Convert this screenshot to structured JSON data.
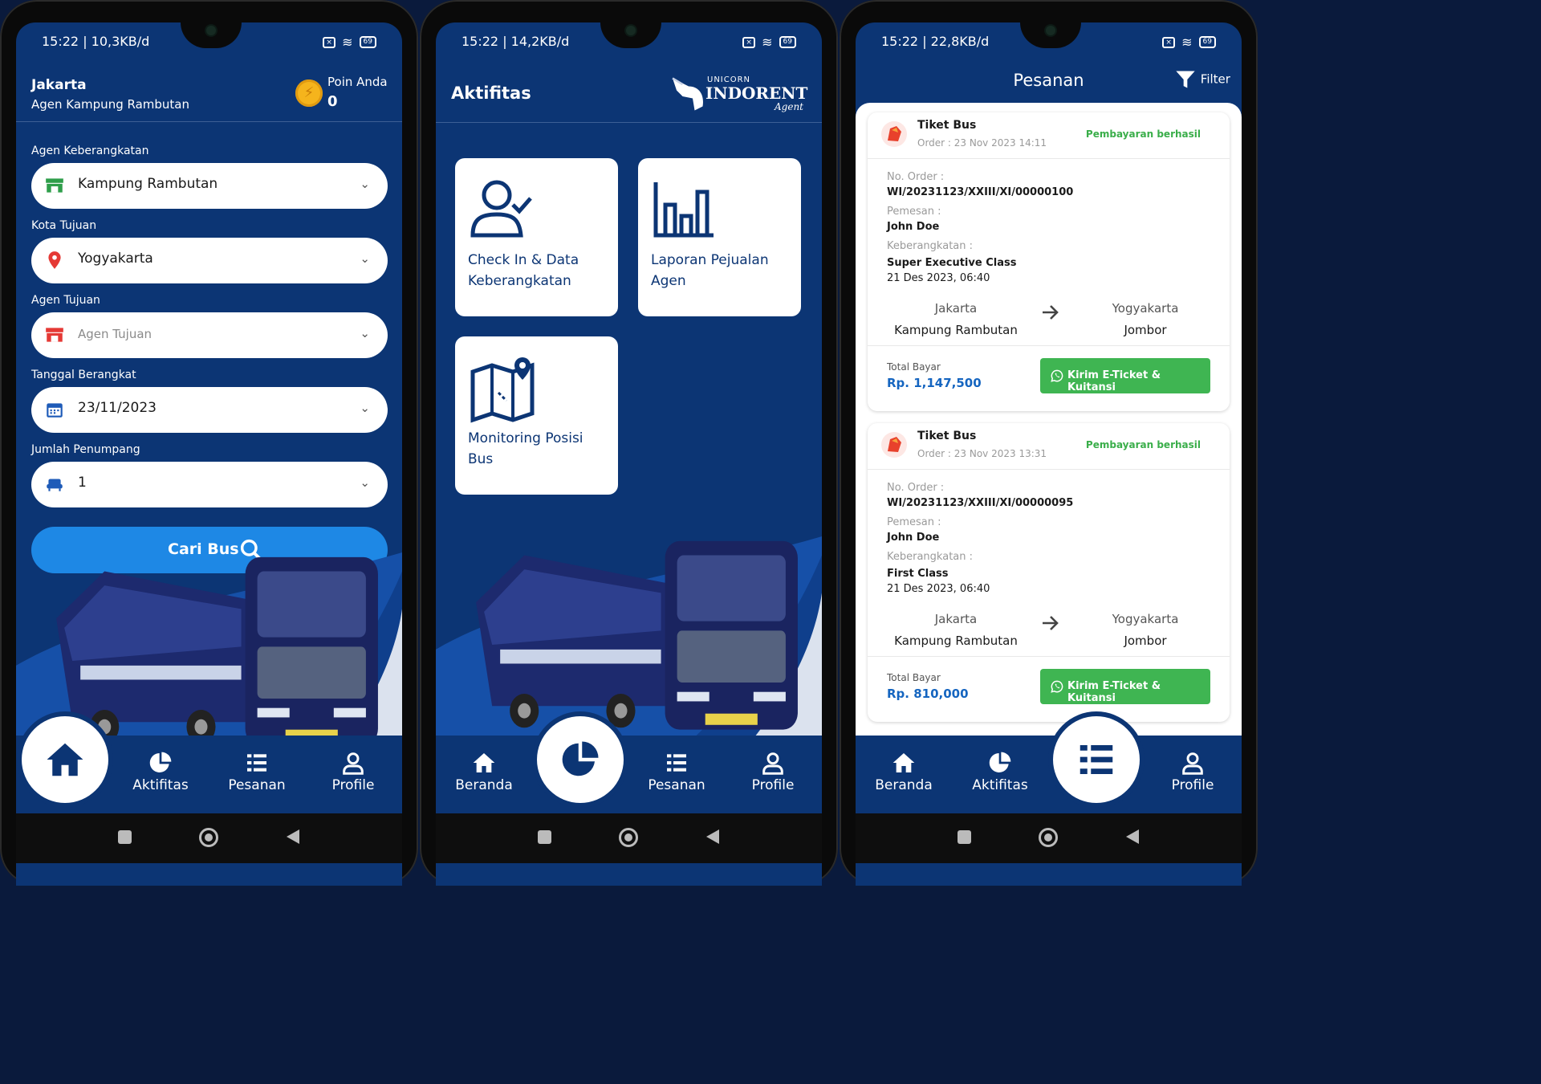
{
  "status_bars": [
    {
      "time": "15:22 | 10,3KB/d",
      "battery": "69"
    },
    {
      "time": "15:22 | 14,2KB/d",
      "battery": "69"
    },
    {
      "time": "15:22 | 22,8KB/d",
      "battery": "69"
    }
  ],
  "home": {
    "city": "Jakarta",
    "agent": "Agen Kampung Rambutan",
    "points_label": "Poin Anda",
    "points_value": "0",
    "fields": [
      {
        "label": "Agen Keberangkatan",
        "value": "Kampung Rambutan",
        "icon": "store-icon",
        "color": "#2e9e4a"
      },
      {
        "label": "Kota Tujuan",
        "value": "Yogyakarta",
        "icon": "location-pin-icon",
        "color": "#e53935"
      },
      {
        "label": "Agen Tujuan",
        "placeholder": "Agen Tujuan",
        "icon": "store-icon",
        "color": "#e53935"
      },
      {
        "label": "Tanggal Berangkat",
        "value": "23/11/2023",
        "icon": "calendar-icon",
        "color": "#1e5bb8"
      },
      {
        "label": "Jumlah Penumpang",
        "value": "1",
        "icon": "seat-icon",
        "color": "#1e5bb8"
      }
    ],
    "search_button": "Cari Bus"
  },
  "aktifitas": {
    "title": "Aktifitas",
    "logo": {
      "top": "UNICORN",
      "main": "INDORENT",
      "sub": "Agent"
    },
    "cards": [
      {
        "label": "Check In & Data Keberangkatan",
        "icon": "user-check-icon"
      },
      {
        "label": "Laporan Pejualan Agen",
        "icon": "bar-chart-icon"
      },
      {
        "label": "Monitoring Posisi Bus",
        "icon": "map-pin-icon"
      }
    ]
  },
  "pesanan": {
    "title": "Pesanan",
    "filter_label": "Filter",
    "orders": [
      {
        "type": "Tiket Bus",
        "order_date": "Order : 23 Nov 2023 14:11",
        "status": "Pembayaran berhasil",
        "no_order_label": "No. Order :",
        "no_order": "WI/20231123/XXIII/XI/00000100",
        "pemesan_label": "Pemesan :",
        "pemesan": "John Doe",
        "keberangkatan_label": "Keberangkatan :",
        "class": "Super Executive Class",
        "departure": "21 Des 2023, 06:40",
        "from_city": "Jakarta",
        "from_agent": "Kampung Rambutan",
        "to_city": "Yogyakarta",
        "to_agent": "Jombor",
        "total_label": "Total Bayar",
        "total": "Rp. 1,147,500",
        "action": "Kirim E-Ticket & Kuitansi"
      },
      {
        "type": "Tiket Bus",
        "order_date": "Order : 23 Nov 2023 13:31",
        "status": "Pembayaran berhasil",
        "no_order_label": "No. Order :",
        "no_order": "WI/20231123/XXIII/XI/00000095",
        "pemesan_label": "Pemesan :",
        "pemesan": "John Doe",
        "keberangkatan_label": "Keberangkatan :",
        "class": "First Class",
        "departure": "21 Des 2023, 06:40",
        "from_city": "Jakarta",
        "from_agent": "Kampung Rambutan",
        "to_city": "Yogyakarta",
        "to_agent": "Jombor",
        "total_label": "Total Bayar",
        "total": "Rp. 810,000",
        "action": "Kirim E-Ticket & Kuitansi"
      }
    ]
  },
  "nav": {
    "beranda": "Beranda",
    "aktifitas": "Aktifitas",
    "pesanan": "Pesanan",
    "profile": "Profile"
  },
  "colors": {
    "primary": "#0c3574",
    "accent": "#1e88e5",
    "success": "#3fb552"
  }
}
